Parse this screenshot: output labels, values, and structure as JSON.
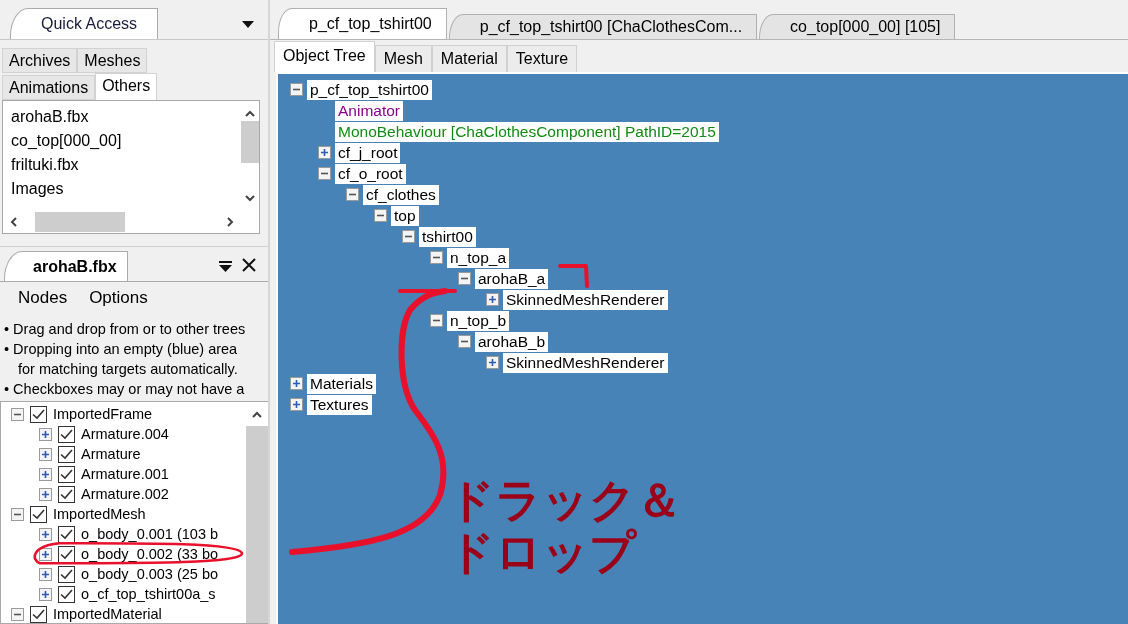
{
  "quick_access": {
    "title": "Quick Access",
    "tabs": [
      {
        "label": "Archives",
        "selected": false
      },
      {
        "label": "Meshes",
        "selected": false
      },
      {
        "label": "Animations",
        "selected": false
      },
      {
        "label": "Others",
        "selected": true
      }
    ],
    "items": [
      "arohaB.fbx",
      "co_top[000_00]",
      "friltuki.fbx",
      "Images"
    ]
  },
  "node_panel": {
    "title": "arohaB.fbx",
    "menu": [
      "Nodes",
      "Options"
    ],
    "help": [
      {
        "kind": "bullet",
        "text": "• Drag and drop from or to other trees"
      },
      {
        "kind": "bullet",
        "text": "• Dropping into an empty (blue) area"
      },
      {
        "kind": "continuation",
        "text": "for matching targets automatically."
      },
      {
        "kind": "bullet",
        "text": "• Checkboxes may or may not have a"
      }
    ],
    "tree": [
      {
        "label": "ImportedFrame",
        "checked": true,
        "expanded": true,
        "children": [
          {
            "label": "Armature.004",
            "checked": true,
            "expanded": false
          },
          {
            "label": "Armature",
            "checked": true,
            "expanded": false
          },
          {
            "label": "Armature.001",
            "checked": true,
            "expanded": false
          },
          {
            "label": "Armature.002",
            "checked": true,
            "expanded": false
          }
        ]
      },
      {
        "label": "ImportedMesh",
        "checked": true,
        "expanded": true,
        "children": [
          {
            "label": "o_body_0.001 (103 b",
            "checked": true,
            "expanded": false
          },
          {
            "label": "o_body_0.002 (33 bo",
            "checked": true,
            "expanded": false
          },
          {
            "label": "o_body_0.003 (25 bo",
            "checked": true,
            "expanded": false
          },
          {
            "label": "o_cf_top_tshirt00a_s",
            "checked": true,
            "expanded": false
          }
        ]
      },
      {
        "label": "ImportedMaterial",
        "checked": true,
        "expanded": true
      }
    ]
  },
  "document_tabs": [
    {
      "label": "p_cf_top_tshirt00",
      "selected": true
    },
    {
      "label": "p_cf_top_tshirt00 [ChaClothesCom...",
      "selected": false
    },
    {
      "label": "co_top[000_00] [105]",
      "selected": false
    }
  ],
  "view_tabs": [
    {
      "label": "Object Tree",
      "selected": true
    },
    {
      "label": "Mesh",
      "selected": false
    },
    {
      "label": "Material",
      "selected": false
    },
    {
      "label": "Texture",
      "selected": false
    }
  ],
  "object_tree": [
    {
      "label": "p_cf_top_tshirt00",
      "color": "#000000",
      "expanded": true,
      "children": [
        {
          "label": "Animator",
          "color": "#8b008b"
        },
        {
          "label": "MonoBehaviour [ChaClothesComponent] PathID=2015",
          "color": "#118a11"
        },
        {
          "label": "cf_j_root",
          "color": "#000000",
          "expanded": false
        },
        {
          "label": "cf_o_root",
          "color": "#000000",
          "expanded": true,
          "children": [
            {
              "label": "cf_clothes",
              "color": "#000000",
              "expanded": true,
              "children": [
                {
                  "label": "top",
                  "color": "#000000",
                  "expanded": true,
                  "children": [
                    {
                      "label": "tshirt00",
                      "color": "#000000",
                      "expanded": true,
                      "children": [
                        {
                          "label": "n_top_a",
                          "color": "#000000",
                          "expanded": true,
                          "children": [
                            {
                              "label": "arohaB_a",
                              "color": "#000000",
                              "expanded": true,
                              "children": [
                                {
                                  "label": "SkinnedMeshRenderer",
                                  "color": "#000000",
                                  "expanded": false
                                }
                              ]
                            }
                          ]
                        },
                        {
                          "label": "n_top_b",
                          "color": "#000000",
                          "expanded": true,
                          "children": [
                            {
                              "label": "arohaB_b",
                              "color": "#000000",
                              "expanded": true,
                              "children": [
                                {
                                  "label": "SkinnedMeshRenderer",
                                  "color": "#000000",
                                  "expanded": false
                                }
                              ]
                            }
                          ]
                        }
                      ]
                    }
                  ]
                }
              ]
            }
          ]
        }
      ]
    },
    {
      "label": "Materials",
      "color": "#000000",
      "expanded": false
    },
    {
      "label": "Textures",
      "color": "#000000",
      "expanded": false
    }
  ],
  "annotation": {
    "lines": [
      "ドラック＆",
      "ドロップ"
    ]
  }
}
